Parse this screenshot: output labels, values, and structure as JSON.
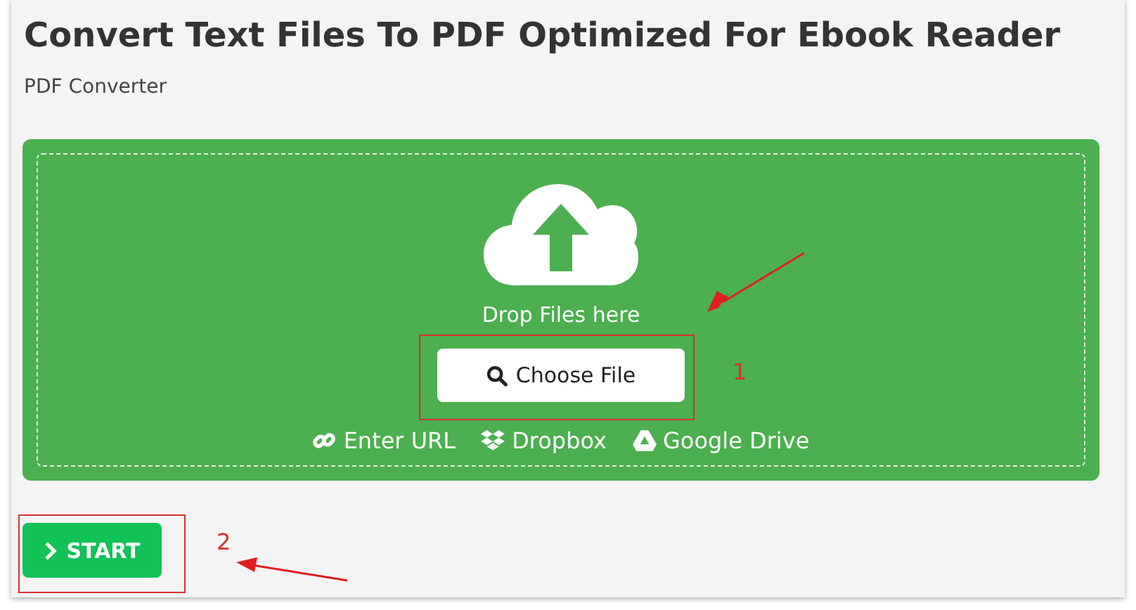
{
  "title": "Convert Text Files To PDF Optimized For Ebook Reader",
  "subtitle": "PDF Converter",
  "dropzone": {
    "prompt": "Drop Files here",
    "choose_button": "Choose File",
    "sources": [
      {
        "kind": "link",
        "label": "Enter URL"
      },
      {
        "kind": "dropbox",
        "label": "Dropbox"
      },
      {
        "kind": "drive",
        "label": "Google Drive"
      }
    ]
  },
  "start_button": "START",
  "annotations": [
    {
      "label": "1"
    },
    {
      "label": "2"
    }
  ]
}
